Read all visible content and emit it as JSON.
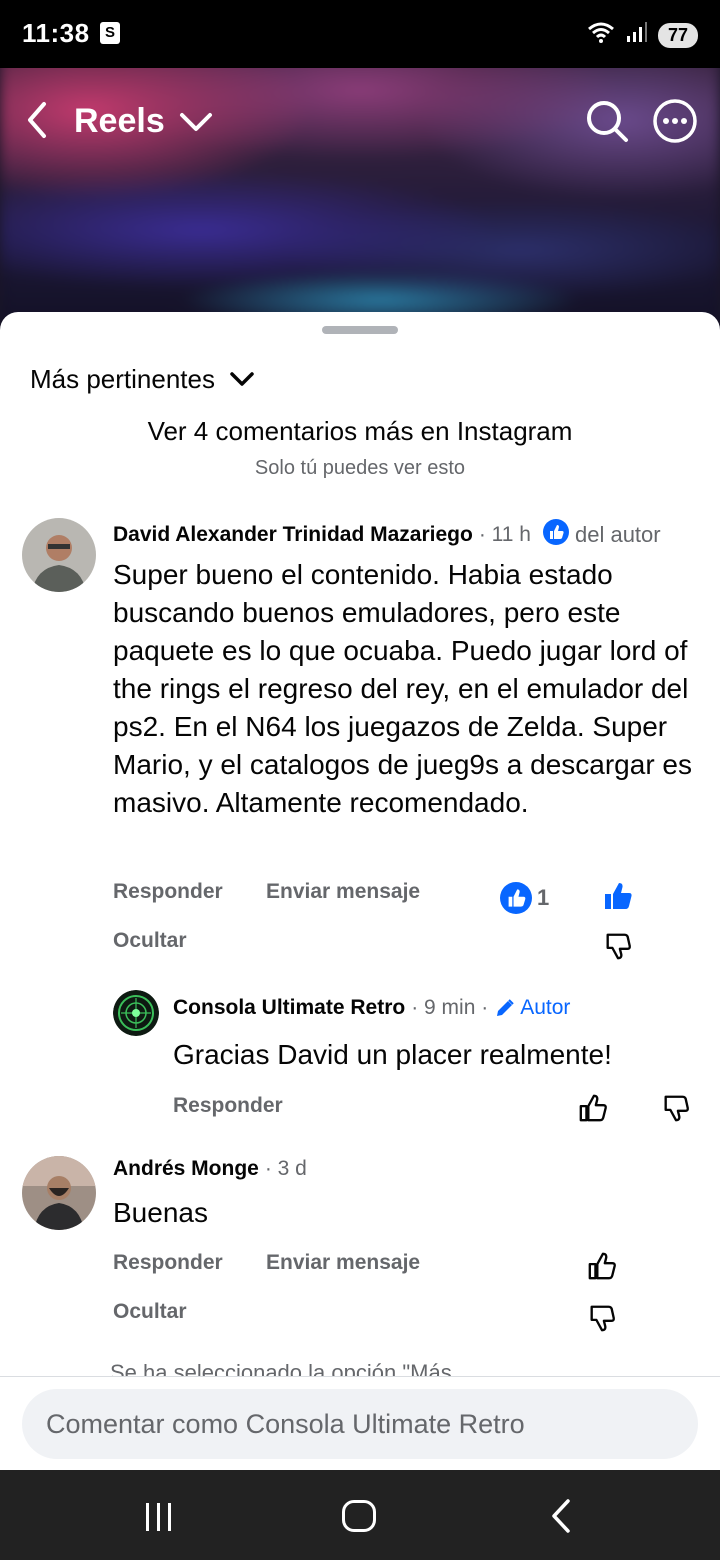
{
  "status": {
    "time": "11:38",
    "battery": "77",
    "app_icon": "shopify-icon",
    "signal": "5"
  },
  "header": {
    "title": "Reels"
  },
  "sheet": {
    "sort_label": "Más pertinentes",
    "ig_link": "Ver 4 comentarios más en Instagram",
    "ig_note": "Solo tú puedes ver esto",
    "partial_text": "Se ha seleccionado la opción \"Más"
  },
  "comments": [
    {
      "name": "David Alexander Trinidad Mazariego",
      "time": "· 11 h",
      "badge": "del autor",
      "body": "Super bueno el contenido. Habia estado buscando buenos emuladores, pero este paquete es lo que ocuaba. Puedo jugar lord of the rings el regreso del rey, en el emulador del ps2. En el N64 los juegazos de Zelda. Super Mario, y el catalogos de jueg9s a descargar es masivo. Altamente recomendado.",
      "reply": "Responder",
      "message": "Enviar mensaje",
      "hide": "Ocultar",
      "likes": "1"
    },
    {
      "name": "Consola Ultimate Retro",
      "time": "· 9 min ·",
      "badge": "Autor",
      "body": "Gracias David un placer realmente!",
      "reply": "Responder"
    },
    {
      "name": "Andrés Monge",
      "time": "· 3 d",
      "body": "Buenas",
      "reply": "Responder",
      "message": "Enviar mensaje",
      "hide": "Ocultar"
    }
  ],
  "compose": {
    "placeholder": "Comentar como Consola Ultimate Retro"
  },
  "colors": {
    "accent": "#0866ff",
    "secondary_text": "#65676b"
  }
}
